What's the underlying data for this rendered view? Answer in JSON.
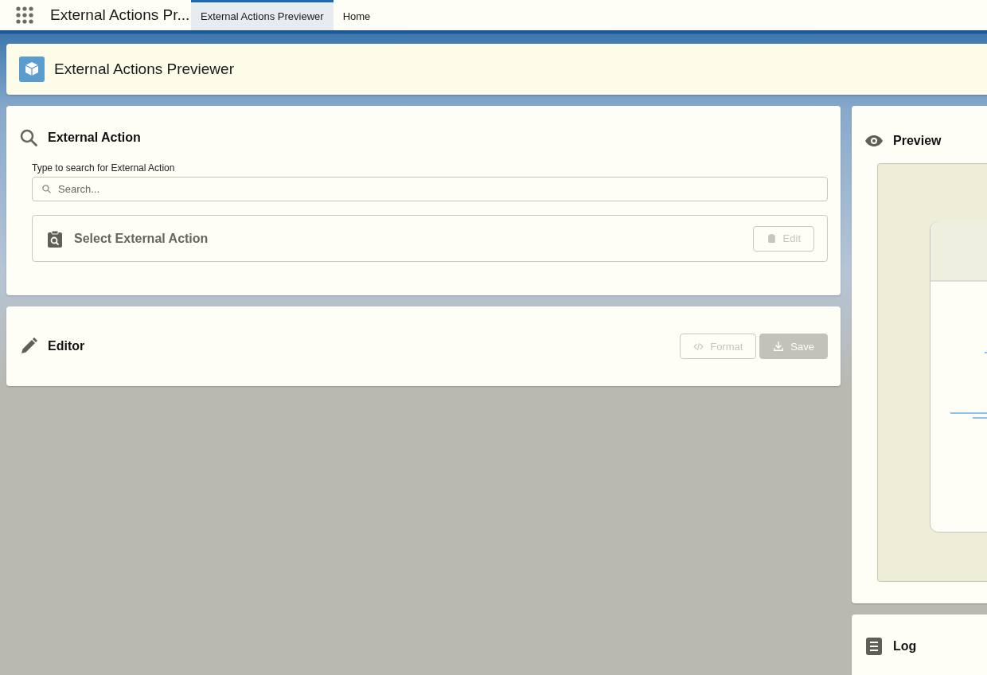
{
  "app_bar": {
    "app_name": "External Actions Pr...",
    "tabs": [
      {
        "label": "External Actions Previewer",
        "selected": true
      },
      {
        "label": "Home",
        "selected": false
      }
    ]
  },
  "page_header": {
    "title": "External Actions Previewer"
  },
  "external_action": {
    "title": "External Action",
    "search_label": "Type to search for External Action",
    "search_placeholder": "Search...",
    "selection_title": "Select External Action",
    "edit_button": {
      "label": "Edit",
      "disabled": true
    }
  },
  "editor": {
    "title": "Editor",
    "format_button": {
      "label": "Format",
      "disabled": true
    },
    "save_button": {
      "label": "Save",
      "disabled": true
    }
  },
  "preview": {
    "title": "Preview"
  },
  "log": {
    "title": "Log"
  }
}
